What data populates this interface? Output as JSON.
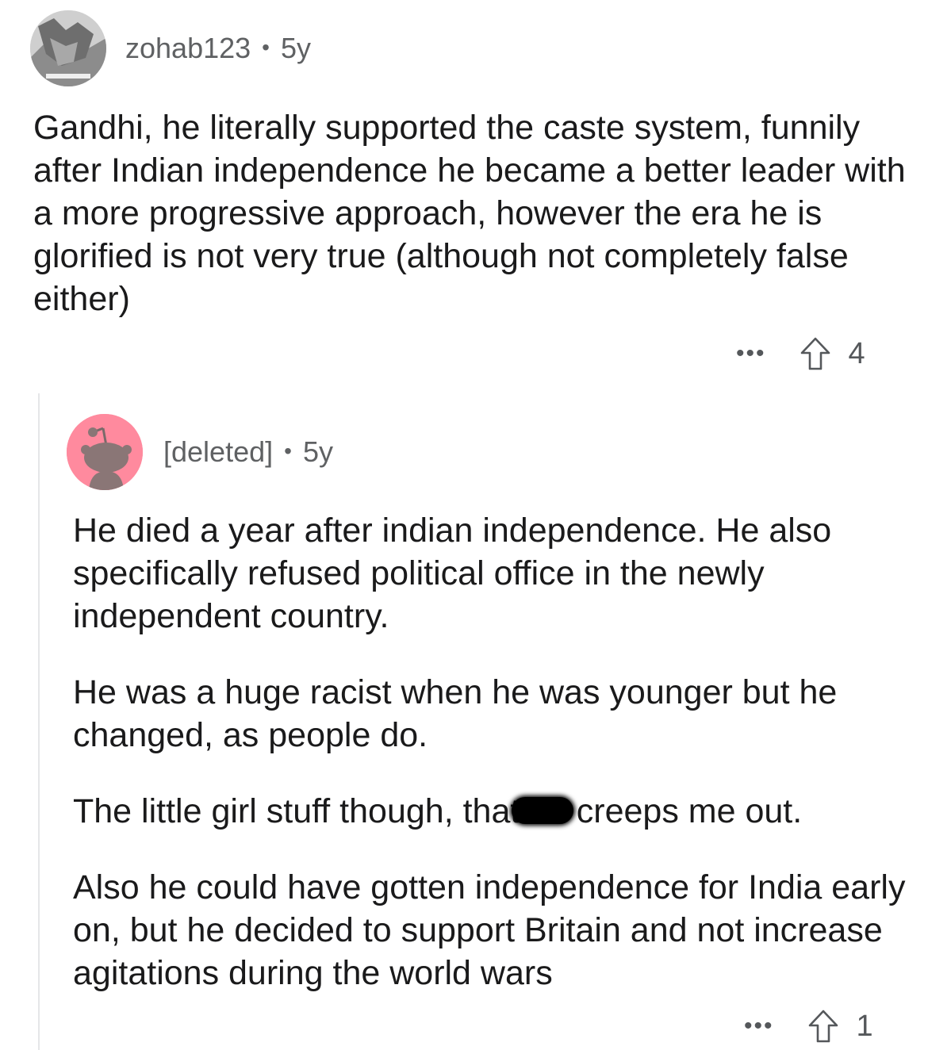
{
  "comments": [
    {
      "author": "zohab123",
      "separator": "•",
      "age": "5y",
      "body": "Gandhi, he literally supported the caste system, funnily after Indian independence he became a better leader with a more progressive approach, however the era he is glorified is not very true (although not completely false either)",
      "more": "•••",
      "score": "4"
    },
    {
      "author": "[deleted]",
      "separator": "•",
      "age": "5y",
      "paragraphs": [
        "He died a year after indian independence. He also specifically refused political office in the newly independent country.",
        "He was a huge racist when he was younger but he changed, as people do.",
        "Also he could have gotten independence for India early on, but he decided to support Britain and not increase agitations during the world wars"
      ],
      "redacted_line": {
        "before": "The little girl stuff though, that s",
        "after": "creeps me out."
      },
      "more": "•••",
      "score": "1"
    }
  ],
  "colors": {
    "meta_text": "#5f6163",
    "body_text": "#1a1a1b",
    "thread_line": "#e5e6e8",
    "deleted_avatar_bg": "#ff8a9e"
  }
}
